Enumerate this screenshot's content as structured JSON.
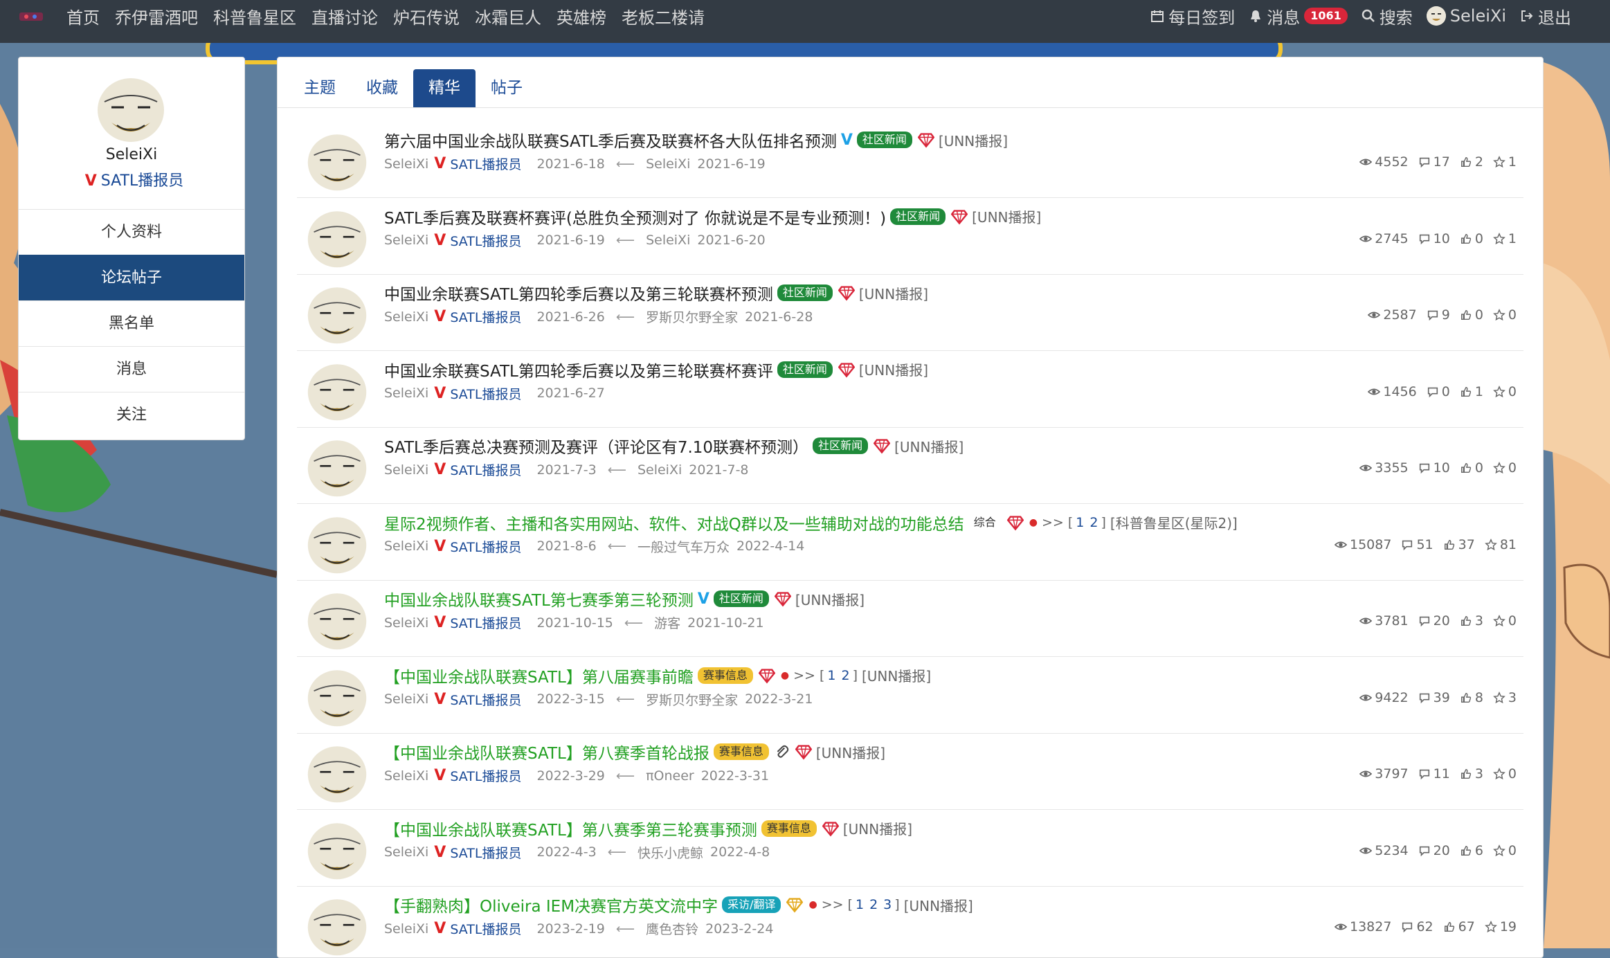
{
  "nav": {
    "items": [
      "首页",
      "乔伊雷酒吧",
      "科普鲁星区",
      "直播讨论",
      "炉石传说",
      "冰霜巨人",
      "英雄榜",
      "老板二楼请"
    ],
    "checkin": "每日签到",
    "messages": "消息",
    "message_count": "1061",
    "search": "搜索",
    "username": "SeleiXi",
    "logout": "退出"
  },
  "profile": {
    "name": "SeleiXi",
    "role": "SATL播报员",
    "menu": [
      "个人资料",
      "论坛帖子",
      "黑名单",
      "消息",
      "关注"
    ],
    "active_menu": "论坛帖子"
  },
  "tabs": {
    "items": [
      "主题",
      "收藏",
      "精华",
      "帖子"
    ],
    "active": "精华"
  },
  "colors": {
    "accent": "#1d4a8c",
    "green_title": "#22a022",
    "news_tag": "#1f8a3a",
    "event_tag": "#f1c232",
    "trans_tag": "#17a2b8",
    "badge_red": "#d9263a"
  },
  "threads": [
    {
      "title": "第六届中国业余战队联赛SATL季后赛及联赛杯各大队伍排名预测",
      "green": false,
      "v": true,
      "tag": "社区新闻",
      "tag_type": "news",
      "gem": "red",
      "forum": "[UNN播报]",
      "author": "SeleiXi",
      "role": "SATL播报员",
      "date": "2021-6-18",
      "last_user": "SeleiXi",
      "last_date": "2021-6-19",
      "views": "4552",
      "replies": "17",
      "likes": "2",
      "stars": "1"
    },
    {
      "title": "SATL季后赛及联赛杯赛评(总胜负全预测对了 你就说是不是专业预测！)",
      "green": false,
      "v": false,
      "tag": "社区新闻",
      "tag_type": "news",
      "gem": "red",
      "forum": "[UNN播报]",
      "author": "SeleiXi",
      "role": "SATL播报员",
      "date": "2021-6-19",
      "last_user": "SeleiXi",
      "last_date": "2021-6-20",
      "views": "2745",
      "replies": "10",
      "likes": "0",
      "stars": "1"
    },
    {
      "title": "中国业余联赛SATL第四轮季后赛以及第三轮联赛杯预测",
      "green": false,
      "v": false,
      "tag": "社区新闻",
      "tag_type": "news",
      "gem": "red",
      "forum": "[UNN播报]",
      "author": "SeleiXi",
      "role": "SATL播报员",
      "date": "2021-6-26",
      "last_user": "罗斯贝尔野全家",
      "last_date": "2021-6-28",
      "views": "2587",
      "replies": "9",
      "likes": "0",
      "stars": "0"
    },
    {
      "title": "中国业余联赛SATL第四轮季后赛以及第三轮联赛杯赛评",
      "green": false,
      "v": false,
      "tag": "社区新闻",
      "tag_type": "news",
      "gem": "red",
      "forum": "[UNN播报]",
      "author": "SeleiXi",
      "role": "SATL播报员",
      "date": "2021-6-27",
      "last_user": "",
      "last_date": "",
      "views": "1456",
      "replies": "0",
      "likes": "1",
      "stars": "0"
    },
    {
      "title": "SATL季后赛总决赛预测及赛评（评论区有7.10联赛杯预测）",
      "green": false,
      "v": false,
      "tag": "社区新闻",
      "tag_type": "news",
      "gem": "red",
      "forum": "[UNN播报]",
      "author": "SeleiXi",
      "role": "SATL播报员",
      "date": "2021-7-3",
      "last_user": "SeleiXi",
      "last_date": "2021-7-8",
      "views": "3355",
      "replies": "10",
      "likes": "0",
      "stars": "0"
    },
    {
      "title": "星际2视频作者、主播和各实用网站、软件、对战Q群以及一些辅助对战的功能总结",
      "green": true,
      "v": false,
      "tag": "综合",
      "tag_type": "plain",
      "gem": "red",
      "pages": [
        "1",
        "2"
      ],
      "forum": "[科普鲁星区(星际2)]",
      "author": "SeleiXi",
      "role": "SATL播报员",
      "date": "2021-8-6",
      "last_user": "一般过气车万众",
      "last_date": "2022-4-14",
      "views": "15087",
      "replies": "51",
      "likes": "37",
      "stars": "81"
    },
    {
      "title": "中国业余战队联赛SATL第七赛季第三轮预测",
      "green": true,
      "v": true,
      "tag": "社区新闻",
      "tag_type": "news",
      "gem": "red",
      "forum": "[UNN播报]",
      "author": "SeleiXi",
      "role": "SATL播报员",
      "date": "2021-10-15",
      "last_user": "游客",
      "last_date": "2021-10-21",
      "views": "3781",
      "replies": "20",
      "likes": "3",
      "stars": "0"
    },
    {
      "title": "【中国业余战队联赛SATL】第八届赛事前瞻",
      "green": true,
      "v": false,
      "tag": "赛事信息",
      "tag_type": "event",
      "gem": "red",
      "pages": [
        "1",
        "2"
      ],
      "forum": "[UNN播报]",
      "author": "SeleiXi",
      "role": "SATL播报员",
      "date": "2022-3-15",
      "last_user": "罗斯贝尔野全家",
      "last_date": "2022-3-21",
      "views": "9422",
      "replies": "39",
      "likes": "8",
      "stars": "3"
    },
    {
      "title": "【中国业余战队联赛SATL】第八赛季首轮战报",
      "green": true,
      "v": false,
      "tag": "赛事信息",
      "tag_type": "event",
      "gem": "red",
      "clip": true,
      "forum": "[UNN播报]",
      "author": "SeleiXi",
      "role": "SATL播报员",
      "date": "2022-3-29",
      "last_user": "πOneer",
      "last_date": "2022-3-31",
      "views": "3797",
      "replies": "11",
      "likes": "3",
      "stars": "0"
    },
    {
      "title": "【中国业余战队联赛SATL】第八赛季第三轮赛事预测",
      "green": true,
      "v": false,
      "tag": "赛事信息",
      "tag_type": "event",
      "gem": "red",
      "forum": "[UNN播报]",
      "author": "SeleiXi",
      "role": "SATL播报员",
      "date": "2022-4-3",
      "last_user": "快乐小虎鲸",
      "last_date": "2022-4-8",
      "views": "5234",
      "replies": "20",
      "likes": "6",
      "stars": "0"
    },
    {
      "title": "【手翻熟肉】Oliveira IEM决赛官方英文流中字",
      "green": true,
      "v": false,
      "tag": "采访/翻译",
      "tag_type": "trans",
      "gem": "gold",
      "pages": [
        "1",
        "2",
        "3"
      ],
      "forum": "[UNN播报]",
      "author": "SeleiXi",
      "role": "SATL播报员",
      "date": "2023-2-19",
      "last_user": "鹰色杏铃",
      "last_date": "2023-2-24",
      "views": "13827",
      "replies": "62",
      "likes": "67",
      "stars": "19"
    }
  ]
}
